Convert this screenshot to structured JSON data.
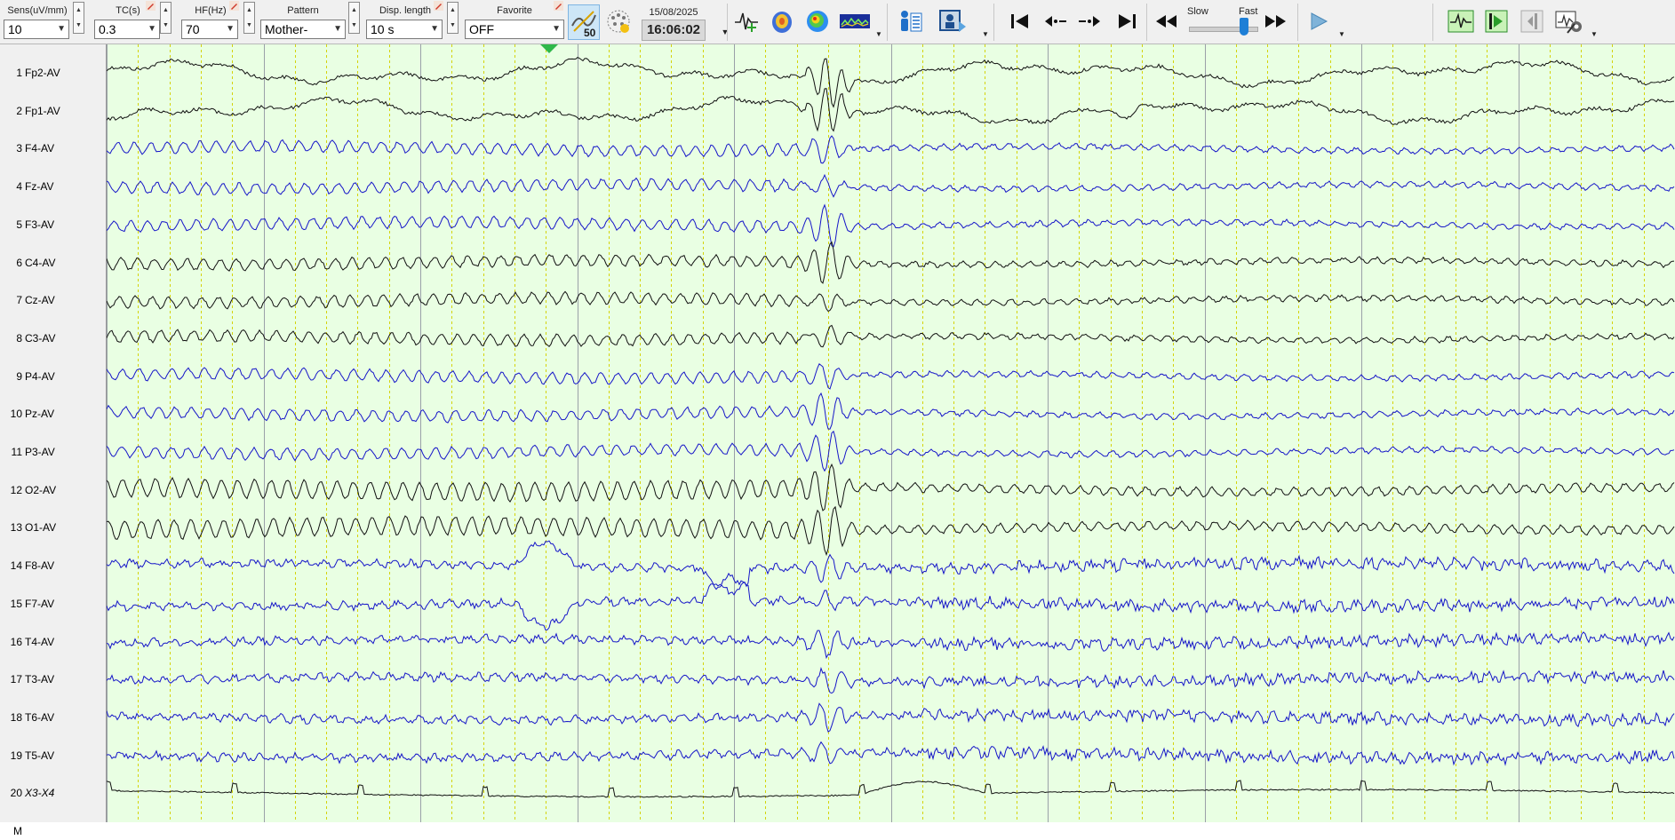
{
  "toolbar": {
    "sens": {
      "label": "Sens(uV/mm)",
      "value": "10"
    },
    "tc": {
      "label": "TC(s)",
      "value": "0.3"
    },
    "hf": {
      "label": "HF(Hz)",
      "value": "70"
    },
    "pattern": {
      "label": "Pattern",
      "value": "Mother-"
    },
    "disp_length": {
      "label": "Disp. length",
      "value": "10 s"
    },
    "favorite": {
      "label": "Favorite",
      "value": "OFF"
    },
    "notch_value": "50",
    "date": "15/08/2025",
    "time": "16:06:02",
    "speed": {
      "slow_label": "Slow",
      "fast_label": "Fast",
      "level": 0.8
    },
    "icons": [
      "pen-icon",
      "notch-filter-icon",
      "electrode-map-icon",
      "waveform-icon",
      "head-map-icon",
      "topography-icon",
      "spectrum-icon",
      "patient-info-icon",
      "video-icon",
      "go-start-icon",
      "step-back-icon",
      "step-forward-icon",
      "go-end-icon",
      "rewind-icon",
      "fast-forward-icon",
      "play-icon",
      "montage-view-icon",
      "marker-icon",
      "panel-icon",
      "settings-icon"
    ]
  },
  "colors": {
    "trace_background": "#e9ffe3",
    "trace_black": "#111111",
    "trace_blue": "#1515c8",
    "second_gridline": "#9aa0a8",
    "sub_gridline": "#d4d40a",
    "accent_blue": "#1e7fd6"
  },
  "display": {
    "seconds": 10,
    "subdivisions_per_second": 5
  },
  "channels": [
    {
      "number": "1",
      "label": "Fp2-AV",
      "color": "black",
      "style": "slow"
    },
    {
      "number": "2",
      "label": "Fp1-AV",
      "color": "black",
      "style": "slow"
    },
    {
      "number": "3",
      "label": "F4-AV",
      "color": "blue",
      "style": "alpha"
    },
    {
      "number": "4",
      "label": "Fz-AV",
      "color": "blue",
      "style": "alpha"
    },
    {
      "number": "5",
      "label": "F3-AV",
      "color": "blue",
      "style": "alpha"
    },
    {
      "number": "6",
      "label": "C4-AV",
      "color": "black",
      "style": "alpha"
    },
    {
      "number": "7",
      "label": "Cz-AV",
      "color": "black",
      "style": "alpha"
    },
    {
      "number": "8",
      "label": "C3-AV",
      "color": "black",
      "style": "alpha"
    },
    {
      "number": "9",
      "label": "P4-AV",
      "color": "blue",
      "style": "alpha"
    },
    {
      "number": "10",
      "label": "Pz-AV",
      "color": "blue",
      "style": "alpha"
    },
    {
      "number": "11",
      "label": "P3-AV",
      "color": "blue",
      "style": "alpha"
    },
    {
      "number": "12",
      "label": "O2-AV",
      "color": "black",
      "style": "alpha-big"
    },
    {
      "number": "13",
      "label": "O1-AV",
      "color": "black",
      "style": "alpha-big"
    },
    {
      "number": "14",
      "label": "F8-AV",
      "color": "blue",
      "style": "emg"
    },
    {
      "number": "15",
      "label": "F7-AV",
      "color": "blue",
      "style": "emg"
    },
    {
      "number": "16",
      "label": "T4-AV",
      "color": "blue",
      "style": "emg"
    },
    {
      "number": "17",
      "label": "T3-AV",
      "color": "blue",
      "style": "emg"
    },
    {
      "number": "18",
      "label": "T6-AV",
      "color": "blue",
      "style": "emg"
    },
    {
      "number": "19",
      "label": "T5-AV",
      "color": "blue",
      "style": "emg"
    },
    {
      "number": "20",
      "label": "X3-X4",
      "color": "black",
      "style": "ecg"
    },
    {
      "number": "M",
      "label": "",
      "color": "black",
      "style": "marker"
    }
  ]
}
